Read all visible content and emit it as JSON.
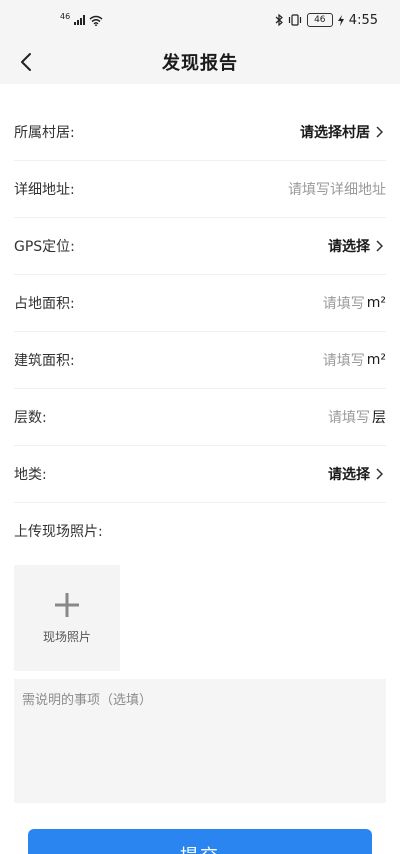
{
  "status_bar": {
    "network": "46",
    "battery": "46",
    "time": "4:55"
  },
  "header": {
    "title": "发现报告",
    "back_icon": "chevron-left-icon"
  },
  "form": {
    "rows": [
      {
        "label": "所属村居:",
        "value": "请选择村居",
        "type": "select"
      },
      {
        "label": "详细地址:",
        "value": "请填写详细地址",
        "type": "input"
      },
      {
        "label": "GPS定位:",
        "value": "请选择",
        "type": "select"
      },
      {
        "label": "占地面积:",
        "value": "请填写",
        "unit": "m²",
        "type": "input"
      },
      {
        "label": "建筑面积:",
        "value": "请填写",
        "unit": "m²",
        "type": "input"
      },
      {
        "label": "层数:",
        "value": "请填写",
        "unit": "层",
        "type": "input"
      },
      {
        "label": "地类:",
        "value": "请选择",
        "type": "select"
      }
    ],
    "upload_label": "上传现场照片:",
    "photo_button_label": "现场照片",
    "remark_placeholder": "需说明的事项（选填）"
  },
  "submit_label": "提交",
  "colors": {
    "primary": "#2a85f0",
    "background_top": "#f5f5f5",
    "placeholder": "#9a9a9a"
  }
}
